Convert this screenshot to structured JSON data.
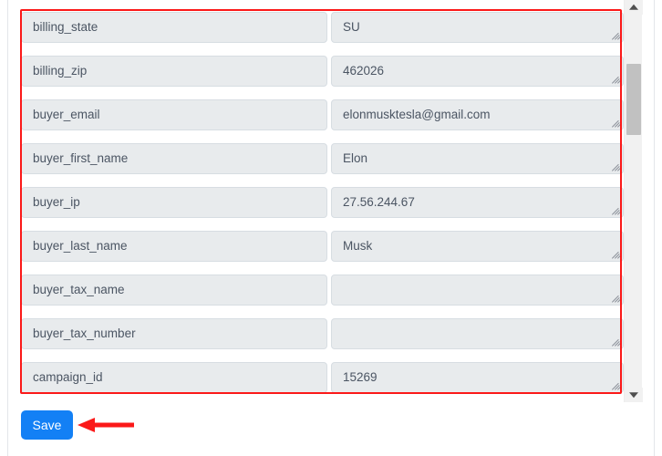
{
  "form": {
    "fields": [
      {
        "key": "billing_state",
        "value": "SU"
      },
      {
        "key": "billing_zip",
        "value": "462026"
      },
      {
        "key": "buyer_email",
        "value": "elonmusktesla@gmail.com"
      },
      {
        "key": "buyer_first_name",
        "value": "Elon"
      },
      {
        "key": "buyer_ip",
        "value": "27.56.244.67"
      },
      {
        "key": "buyer_last_name",
        "value": "Musk"
      },
      {
        "key": "buyer_tax_name",
        "value": ""
      },
      {
        "key": "buyer_tax_number",
        "value": ""
      },
      {
        "key": "campaign_id",
        "value": "15269"
      }
    ]
  },
  "actions": {
    "save_label": "Save"
  },
  "annotation": {
    "highlight_color": "#fb1919",
    "arrow_color": "#fb1919",
    "arrow_direction": "left"
  },
  "scrollbar": {
    "up_arrow": "scroll-up",
    "down_arrow": "scroll-down",
    "thumb": "scroll-thumb"
  },
  "colors": {
    "field_bg": "#e8ebed",
    "field_border": "#d7dde2",
    "field_text": "#4b5563",
    "save_bg": "#1380f5",
    "save_text": "#ffffff"
  }
}
